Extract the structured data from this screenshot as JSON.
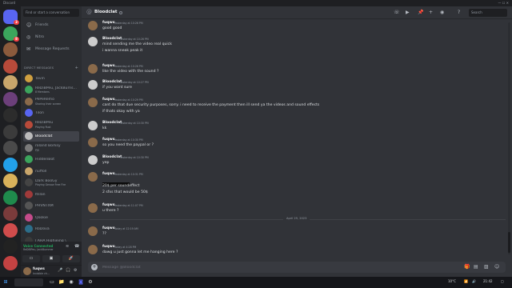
{
  "window": {
    "title": "Discord",
    "controls": "— ☐ ✕"
  },
  "server_rail": {
    "servers": [
      {
        "name": "Discord home",
        "color": "#5865f2",
        "badge": "3"
      },
      {
        "name": "server-1",
        "color": "#3ba55c",
        "badge": "8"
      },
      {
        "name": "server-2",
        "color": "#8b5a3c",
        "badge": ""
      },
      {
        "name": "server-3",
        "color": "#b84a3a",
        "badge": ""
      },
      {
        "name": "server-4",
        "color": "#c9a66b",
        "badge": ""
      },
      {
        "name": "server-5",
        "color": "#6c3f7a",
        "badge": ""
      },
      {
        "name": "server-6",
        "color": "#2c2c2c",
        "badge": ""
      },
      {
        "name": "server-7",
        "color": "#3b3b3b",
        "badge": ""
      },
      {
        "name": "server-8",
        "color": "#4a4a4a",
        "badge": ""
      },
      {
        "name": "server-9",
        "color": "#22a0e8",
        "badge": ""
      },
      {
        "name": "server-10",
        "color": "#d9b15a",
        "badge": ""
      },
      {
        "name": "server-11",
        "color": "#1f8b4c",
        "badge": ""
      },
      {
        "name": "server-12",
        "color": "#7a3b3b",
        "badge": ""
      },
      {
        "name": "server-13",
        "color": "#d04c4c",
        "badge": ""
      },
      {
        "name": "server-14",
        "color": "#222222",
        "badge": ""
      },
      {
        "name": "server-15",
        "color": "#c44242",
        "badge": ""
      }
    ]
  },
  "dm_panel": {
    "search_placeholder": "Find or start a conversation",
    "nav": [
      {
        "label": "Friends",
        "icon": "friends-icon",
        "glyph": "☺"
      },
      {
        "label": "Nitro",
        "icon": "nitro-icon",
        "glyph": "◎"
      },
      {
        "label": "Message Requests",
        "icon": "mail-icon",
        "glyph": "✉"
      }
    ],
    "section_header": "DIRECT MESSAGES",
    "dms": [
      {
        "name": "Tavin",
        "sub": "",
        "color": "#d0a040"
      },
      {
        "name": "ReDiBPeu, JackBurns...",
        "sub": "8 Members",
        "color": "#3ba55c"
      },
      {
        "name": "PePeRemo",
        "sub": "Sharing their screen",
        "color": "#8a6a4a"
      },
      {
        "name": "Tilon",
        "sub": "",
        "color": "#5865f2"
      },
      {
        "name": "ReDiBPeu",
        "sub": "Playing Rust",
        "color": "#b84a3a"
      },
      {
        "name": "Bloodclat",
        "sub": "",
        "color": "#bbbbbb"
      },
      {
        "name": "roland Borksy",
        "sub": "PJS",
        "color": "#7a7a7a"
      },
      {
        "name": "HiddenBot",
        "sub": "",
        "color": "#3ba55c"
      },
      {
        "name": "nuffoll",
        "sub": "",
        "color": "#c9a66b"
      },
      {
        "name": "Dark BooGy",
        "sub": "Playing Genow Free Fire",
        "color": "#444444"
      },
      {
        "name": "Itslan",
        "sub": "",
        "color": "#a03a3a"
      },
      {
        "name": "PHVNTXM",
        "sub": "",
        "color": "#555555"
      },
      {
        "name": "Qookie",
        "sub": "",
        "color": "#c44b8a"
      },
      {
        "name": "RoDova",
        "sub": "",
        "color": "#2c6e8a"
      },
      {
        "name": "l AHA Highjeing \\",
        "sub": "",
        "color": "#3a3a3a"
      }
    ],
    "voice": {
      "status": "Voice Connected",
      "channel": "ReDiBPeu, JackBurnmer"
    },
    "user": {
      "name": "fuqws",
      "status": "Invisible ch..."
    }
  },
  "header": {
    "name": "Bloodclat",
    "search_placeholder": "Search"
  },
  "messages": [
    {
      "author": "fuqws",
      "time": "Yesterday at 10:26 PM",
      "lines": [
        "good good"
      ],
      "color": "#8a6a4a"
    },
    {
      "author": "Bloodclat",
      "time": "Yesterday at 10:26 PM",
      "lines": [
        "mind sending me the video real quick",
        "i wanna sneak peak it"
      ],
      "color": "#cccccc"
    },
    {
      "author": "fuqws",
      "time": "Yesterday at 10:26 PM",
      "lines": [
        "like the video with the sound ?"
      ],
      "color": "#8a6a4a"
    },
    {
      "author": "Bloodclat",
      "time": "Yesterday at 10:27 PM",
      "lines": [
        "if you want sure"
      ],
      "color": "#cccccc"
    },
    {
      "author": "fuqws",
      "time": "Yesterday at 10:29 PM",
      "lines": [
        "cant do that due security purposes, sorry. i need to receive the payment then ill send ya the videos and sound effects",
        "if thats okay with ya"
      ],
      "color": "#8a6a4a"
    },
    {
      "author": "Bloodclat",
      "time": "Yesterday at 10:30 PM",
      "lines": [
        "kk"
      ],
      "color": "#cccccc"
    },
    {
      "author": "fuqws",
      "time": "Yesterday at 10:30 PM",
      "lines": [
        "so you need the paypal or ?"
      ],
      "color": "#8a6a4a"
    },
    {
      "author": "Bloodclat",
      "time": "Yesterday at 10:30 PM",
      "lines": [
        "yep"
      ],
      "color": "#cccccc"
    },
    {
      "author": "fuqws",
      "time": "Yesterday at 10:31 PM",
      "lines": [
        "",
        "20$ per soundeffect",
        "2 sfxs that would be 50$"
      ],
      "color": "#8a6a4a"
    },
    {
      "author": "fuqws",
      "time": "Yesterday at 11:07 PM",
      "lines": [
        "u there ?"
      ],
      "color": "#8a6a4a"
    },
    {
      "author": "fuqws",
      "time": "Today at 12:19 AM",
      "lines": [
        "??"
      ],
      "color": "#8a6a4a"
    },
    {
      "author": "fuqws",
      "time": "Today at 4:28 PM",
      "lines": [
        "dawg u just gonna let me hanging here ?"
      ],
      "color": "#8a6a4a"
    }
  ],
  "date_divider": "April 29, 2023",
  "composer": {
    "placeholder": "Message @Bloodclat"
  },
  "taskbar": {
    "clock": "21:42",
    "weather": "10°C"
  }
}
